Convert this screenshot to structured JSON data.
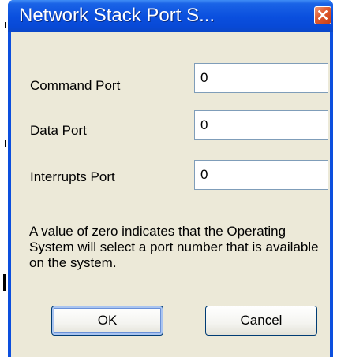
{
  "dialog": {
    "title": "Network Stack Port S...",
    "close_icon": "close-icon",
    "fields": [
      {
        "label": "Command Port",
        "value": "0"
      },
      {
        "label": "Data Port",
        "value": "0"
      },
      {
        "label": "Interrupts Port",
        "value": "0"
      }
    ],
    "info_text": "A value of zero indicates that the Operating System will select a port number that is available on the system.",
    "buttons": {
      "ok_label": "OK",
      "cancel_label": "Cancel"
    }
  },
  "colors": {
    "titlebar": "#0a4fde",
    "client": "#ece9d8",
    "close_button": "#e05a2e"
  }
}
